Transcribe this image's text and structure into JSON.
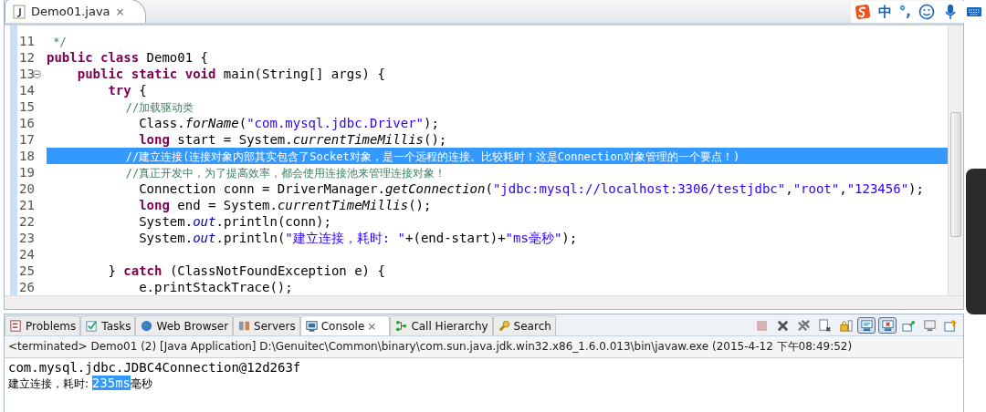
{
  "editor_tabs": [
    {
      "label": "Demo01.java",
      "close": "⨯",
      "selected": true
    }
  ],
  "ime_toolbar": {
    "mode": "中",
    "punctuation": "°,"
  },
  "code_lines": [
    {
      "number": "11",
      "foldable": false,
      "selected": false,
      "tokens": [
        {
          "kind": "comment",
          "text": " */"
        }
      ]
    },
    {
      "number": "12",
      "foldable": false,
      "selected": false,
      "tokens": [
        {
          "kind": "keyword",
          "text": "public class"
        },
        {
          "kind": "plain",
          "text": " Demo01 {"
        }
      ]
    },
    {
      "number": "13",
      "foldable": true,
      "selected": false,
      "tokens": [
        {
          "kind": "keyword",
          "text": "    public static void"
        },
        {
          "kind": "plain",
          "text": " main(String[] args) {"
        }
      ]
    },
    {
      "number": "14",
      "foldable": false,
      "selected": false,
      "tokens": [
        {
          "kind": "keyword",
          "text": "        try"
        },
        {
          "kind": "plain",
          "text": " {"
        }
      ]
    },
    {
      "number": "15",
      "foldable": false,
      "selected": false,
      "tokens": [
        {
          "kind": "comment",
          "text": "            //加载驱动类"
        }
      ]
    },
    {
      "number": "16",
      "foldable": false,
      "selected": false,
      "tokens": [
        {
          "kind": "plain",
          "text": "            Class."
        },
        {
          "kind": "italic",
          "text": "forName"
        },
        {
          "kind": "plain",
          "text": "("
        },
        {
          "kind": "string",
          "text": "\"com.mysql.jdbc.Driver\""
        },
        {
          "kind": "plain",
          "text": ");"
        }
      ]
    },
    {
      "number": "17",
      "foldable": false,
      "selected": false,
      "tokens": [
        {
          "kind": "keyword",
          "text": "            long"
        },
        {
          "kind": "plain",
          "text": " start = System."
        },
        {
          "kind": "italic",
          "text": "currentTimeMillis"
        },
        {
          "kind": "plain",
          "text": "();"
        }
      ]
    },
    {
      "number": "18",
      "foldable": false,
      "selected": true,
      "tokens": [
        {
          "kind": "comment",
          "text": "            //建立连接(连接对象内部其实包含了Socket对象，是一个远程的连接。比较耗时！这是Connection对象管理的一个要点！)"
        }
      ]
    },
    {
      "number": "19",
      "foldable": false,
      "selected": false,
      "tokens": [
        {
          "kind": "comment",
          "text": "            //真正开发中，为了提高效率，都会使用连接池来管理连接对象！"
        }
      ]
    },
    {
      "number": "20",
      "foldable": false,
      "selected": false,
      "tokens": [
        {
          "kind": "plain",
          "text": "            Connection conn = DriverManager."
        },
        {
          "kind": "italic",
          "text": "getConnection"
        },
        {
          "kind": "plain",
          "text": "("
        },
        {
          "kind": "string",
          "text": "\"jdbc:mysql://localhost:3306/testjdbc\""
        },
        {
          "kind": "plain",
          "text": ","
        },
        {
          "kind": "string",
          "text": "\"root\""
        },
        {
          "kind": "plain",
          "text": ","
        },
        {
          "kind": "string",
          "text": "\"123456\""
        },
        {
          "kind": "plain",
          "text": ");"
        }
      ]
    },
    {
      "number": "21",
      "foldable": false,
      "selected": false,
      "tokens": [
        {
          "kind": "keyword",
          "text": "            long"
        },
        {
          "kind": "plain",
          "text": " end = System."
        },
        {
          "kind": "italic",
          "text": "currentTimeMillis"
        },
        {
          "kind": "plain",
          "text": "();"
        }
      ]
    },
    {
      "number": "22",
      "foldable": false,
      "selected": false,
      "tokens": [
        {
          "kind": "plain",
          "text": "            System."
        },
        {
          "kind": "field",
          "text": "out"
        },
        {
          "kind": "plain",
          "text": ".println(conn);"
        }
      ]
    },
    {
      "number": "23",
      "foldable": false,
      "selected": false,
      "tokens": [
        {
          "kind": "plain",
          "text": "            System."
        },
        {
          "kind": "field",
          "text": "out"
        },
        {
          "kind": "plain",
          "text": ".println("
        },
        {
          "kind": "string",
          "text": "\"建立连接，耗时: \""
        },
        {
          "kind": "plain",
          "text": "+(end-start)+"
        },
        {
          "kind": "string",
          "text": "\"ms毫秒\""
        },
        {
          "kind": "plain",
          "text": ");"
        }
      ]
    },
    {
      "number": "24",
      "foldable": false,
      "selected": false
    },
    {
      "number": "25",
      "foldable": false,
      "selected": false,
      "tokens": [
        {
          "kind": "plain",
          "text": "        } "
        },
        {
          "kind": "keyword",
          "text": "catch"
        },
        {
          "kind": "plain",
          "text": " (ClassNotFoundException e) {"
        }
      ]
    },
    {
      "number": "26",
      "foldable": false,
      "selected": false,
      "tokens": [
        {
          "kind": "plain",
          "text": "            e.printStackTrace();"
        }
      ]
    }
  ],
  "view_tabs": [
    {
      "label": "Problems",
      "selected": false
    },
    {
      "label": "Tasks",
      "selected": false
    },
    {
      "label": "Web Browser",
      "selected": false
    },
    {
      "label": "Servers",
      "selected": false
    },
    {
      "label": "Console",
      "selected": true,
      "close": "⨯"
    },
    {
      "label": "Call Hierarchy",
      "selected": false
    },
    {
      "label": "Search",
      "selected": false
    }
  ],
  "toolbar": [
    {
      "pressed": false
    },
    {
      "pressed": false
    },
    {
      "pressed": false
    },
    {
      "pressed": false
    },
    {
      "pressed": false
    },
    {
      "pressed": true
    },
    {
      "pressed": true
    },
    {
      "pressed": false
    },
    {
      "pressed": false
    },
    {
      "pressed": false
    }
  ],
  "console_status": "<terminated> Demo01 (2) [Java Application] D:\\Genuitec\\Common\\binary\\com.sun.java.jdk.win32.x86_1.6.0.013\\bin\\javaw.exe (2015-4-12 下午08:49:52)",
  "console_lines": [
    {
      "kind": "mono",
      "segments": [
        {
          "text": "com.mysql.jdbc.JDBC4Connection@12d263f",
          "selected": false
        }
      ]
    },
    {
      "kind": "sans",
      "segments": [
        {
          "text": "建立连接，耗时: ",
          "selected": false
        },
        {
          "text": "235ms",
          "selected": true
        },
        {
          "text": "毫秒",
          "selected": false
        }
      ]
    }
  ]
}
